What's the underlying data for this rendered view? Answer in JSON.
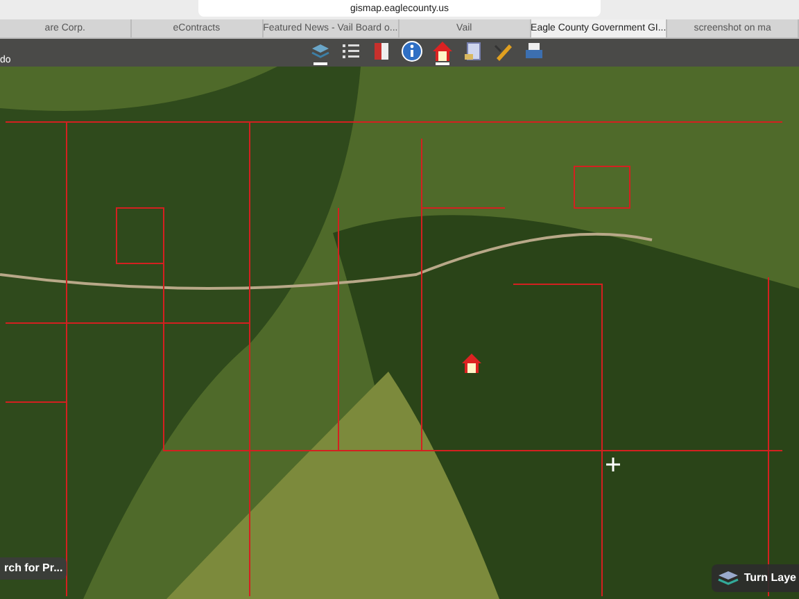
{
  "address_bar": {
    "url": "gismap.eaglecounty.us"
  },
  "tabs": [
    {
      "label": "are Corp.",
      "selected": false
    },
    {
      "label": "eContracts",
      "selected": false
    },
    {
      "label": "Featured News - Vail Board o...",
      "selected": false
    },
    {
      "label": "Vail",
      "selected": false
    },
    {
      "label": "Eagle County Government GI...",
      "selected": true
    },
    {
      "label": "screenshot on ma",
      "selected": false
    }
  ],
  "toolbar": {
    "title": "do",
    "tools": [
      {
        "kind": "layers",
        "active": true
      },
      {
        "kind": "legend",
        "active": false
      },
      {
        "kind": "book",
        "active": false
      },
      {
        "kind": "info",
        "active": false
      },
      {
        "kind": "home",
        "active": true
      },
      {
        "kind": "print",
        "active": false
      },
      {
        "kind": "measure",
        "active": false
      },
      {
        "kind": "printer",
        "active": false
      }
    ]
  },
  "map": {
    "search_button": "rch for Pr...",
    "layers_button": "Turn Laye"
  }
}
